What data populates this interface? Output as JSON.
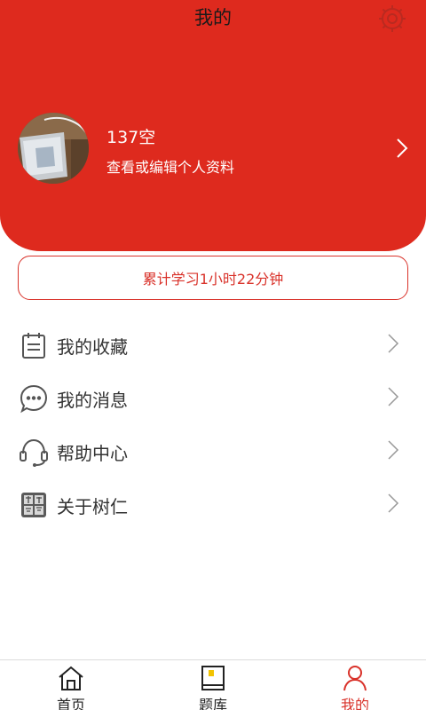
{
  "header": {
    "title": "我的"
  },
  "profile": {
    "name": "137空",
    "subtitle": "查看或编辑个人资料"
  },
  "study": {
    "text": "累计学习1小时22分钟"
  },
  "menu": [
    {
      "label": "我的收藏",
      "icon": "calendar-icon"
    },
    {
      "label": "我的消息",
      "icon": "message-icon"
    },
    {
      "label": "帮助中心",
      "icon": "headset-icon"
    },
    {
      "label": "关于树仁",
      "icon": "logo-seal-icon"
    }
  ],
  "tabs": [
    {
      "label": "首页",
      "icon": "home-icon"
    },
    {
      "label": "题库",
      "icon": "book-icon"
    },
    {
      "label": "我的",
      "icon": "user-icon",
      "active": true
    }
  ],
  "colors": {
    "brand_red": "#de2a1e",
    "accent_red": "#d9322a"
  }
}
